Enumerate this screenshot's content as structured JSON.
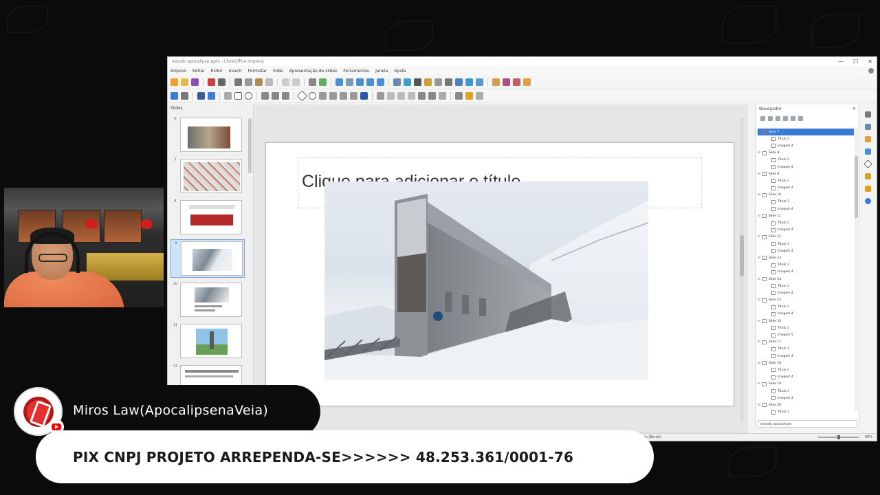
{
  "window": {
    "title": "estudo apocalipse.pptx - LibreOffice Impress",
    "minimize": "—",
    "maximize": "☐",
    "close": "✕"
  },
  "menu": [
    "Arquivo",
    "Editar",
    "Exibir",
    "Inserir",
    "Formatar",
    "Slide",
    "Apresentação de slides",
    "Ferramentas",
    "Janela",
    "Ajuda"
  ],
  "slides_pane": {
    "title": "Slides",
    "thumbnails": [
      {
        "num": "6"
      },
      {
        "num": "7"
      },
      {
        "num": "8"
      },
      {
        "num": "9"
      },
      {
        "num": "10"
      },
      {
        "num": "11"
      },
      {
        "num": "12"
      }
    ]
  },
  "slide": {
    "title_placeholder": "Clique para adicionar o título"
  },
  "navigator": {
    "title": "Navegador",
    "close": "✕",
    "footer": "estudo apocalipse",
    "items": [
      {
        "label": "Slide 7",
        "level": 0,
        "selected": true
      },
      {
        "label": "Título 1",
        "level": 1
      },
      {
        "label": "Imagem 4",
        "level": 1
      },
      {
        "label": "Slide 8",
        "level": 0
      },
      {
        "label": "Título 1",
        "level": 1
      },
      {
        "label": "Imagem 4",
        "level": 1
      },
      {
        "label": "Slide 9",
        "level": 0
      },
      {
        "label": "Título 1",
        "level": 1
      },
      {
        "label": "Imagem 4",
        "level": 1
      },
      {
        "label": "Slide 10",
        "level": 0
      },
      {
        "label": "Título 1",
        "level": 1
      },
      {
        "label": "Imagem 4",
        "level": 1
      },
      {
        "label": "Slide 11",
        "level": 0
      },
      {
        "label": "Título 1",
        "level": 1
      },
      {
        "label": "Imagem 4",
        "level": 1
      },
      {
        "label": "Slide 12",
        "level": 0
      },
      {
        "label": "Título 1",
        "level": 1
      },
      {
        "label": "Imagem 4",
        "level": 1
      },
      {
        "label": "Slide 13",
        "level": 0
      },
      {
        "label": "Título 1",
        "level": 1
      },
      {
        "label": "Imagem 4",
        "level": 1
      },
      {
        "label": "Slide 14",
        "level": 0
      },
      {
        "label": "Título 1",
        "level": 1
      },
      {
        "label": "Imagem 4",
        "level": 1
      },
      {
        "label": "Slide 15",
        "level": 0
      },
      {
        "label": "Título 1",
        "level": 1
      },
      {
        "label": "Imagem 4",
        "level": 1
      },
      {
        "label": "Slide 16",
        "level": 0
      },
      {
        "label": "Título 1",
        "level": 1
      },
      {
        "label": "Imagem 5",
        "level": 1
      },
      {
        "label": "Slide 17",
        "level": 0
      },
      {
        "label": "Título 1",
        "level": 1
      },
      {
        "label": "Imagem 4",
        "level": 1
      },
      {
        "label": "Slide 18",
        "level": 0
      },
      {
        "label": "Título 1",
        "level": 1
      },
      {
        "label": "Imagem 4",
        "level": 1
      },
      {
        "label": "Slide 19",
        "level": 0
      },
      {
        "label": "Título 1",
        "level": 1
      },
      {
        "label": "Imagem 4",
        "level": 1
      },
      {
        "label": "Slide 20",
        "level": 0
      },
      {
        "label": "Título 1",
        "level": 1
      }
    ]
  },
  "statusbar": {
    "layout": "Retângulo (Bordô)",
    "zoom": "98%"
  },
  "overlay": {
    "channel_name": "Miros Law(ApocalipsenaVeia)",
    "pix_text": "PIX CNPJ PROJETO ARREPENDA-SE>>>>>> 48.253.361/0001-76"
  },
  "colors": {
    "accent": "#3a7bd5",
    "logo_red": "#e43030",
    "youtube_red": "#ff0000"
  }
}
